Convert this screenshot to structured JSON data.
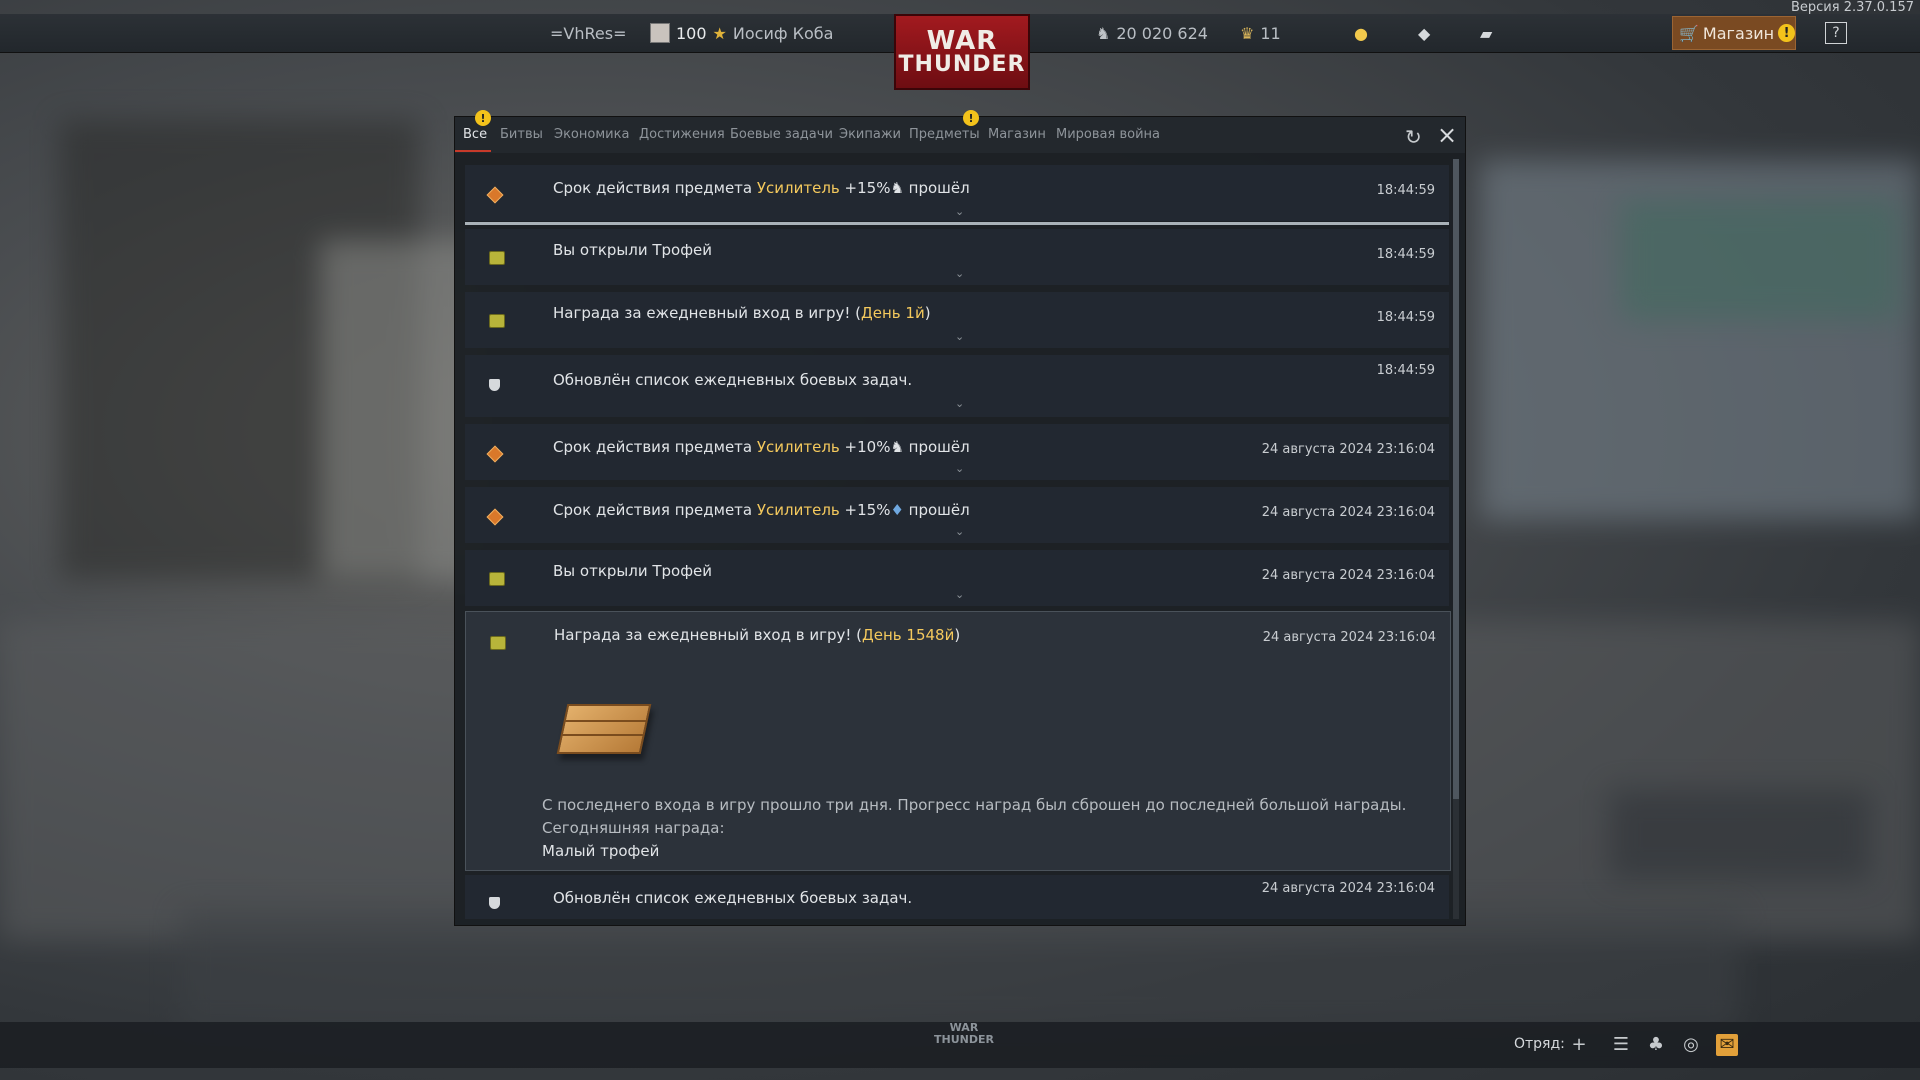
{
  "version": "Версия 2.37.0.157",
  "topbar": {
    "squadron": "=VhRes=",
    "level": "100",
    "player_name": "Иосиф Коба",
    "logo_line1": "WAR",
    "logo_line2": "THUNDER",
    "silver_lions": "20 020 624",
    "eagles": "11",
    "shop_label": "Магазин"
  },
  "tabs": [
    "Все",
    "Битвы",
    "Экономика",
    "Достижения",
    "Боевые задачи",
    "Экипажи",
    "Предметы",
    "Магазин",
    "Мировая война"
  ],
  "messages": [
    {
      "pre": "Срок действия предмета ",
      "hl": "Усилитель",
      "post": " +15%",
      "post2": " прошёл",
      "time": "18:44:59"
    },
    {
      "pre": "Вы открыли Трофей",
      "time": "18:44:59"
    },
    {
      "pre": "Награда за ежедневный вход в игру! (",
      "hl": "День 1й",
      "post": ")",
      "time": "18:44:59"
    },
    {
      "pre": "Обновлён список ежедневных боевых задач.",
      "time": "18:44:59"
    },
    {
      "pre": "Срок действия предмета ",
      "hl": "Усилитель",
      "post": " +10%",
      "post2": " прошёл",
      "time": "24 августа 2024 23:16:04"
    },
    {
      "pre": "Срок действия предмета ",
      "hl": "Усилитель",
      "post": " +15%",
      "post2": " прошёл",
      "time": "24 августа 2024 23:16:04"
    },
    {
      "pre": "Вы открыли Трофей",
      "time": "24 августа 2024 23:16:04"
    },
    {
      "pre": "Награда за ежедневный вход в игру! (",
      "hl": "День 1548й",
      "post": ")",
      "time": "24 августа 2024 23:16:04",
      "detail1": "С последнего входа в игру прошло три дня. Прогресс наград был сброшен до последней большой награды.",
      "detail2": "Сегодняшняя награда:",
      "detail3": "Малый трофей"
    },
    {
      "pre": "Обновлён список ежедневных боевых задач.",
      "time": "24 августа 2024 23:16:04"
    }
  ],
  "bottombar": {
    "squad_label": "Отряд:",
    "logo_line1": "WAR",
    "logo_line2": "THUNDER"
  }
}
